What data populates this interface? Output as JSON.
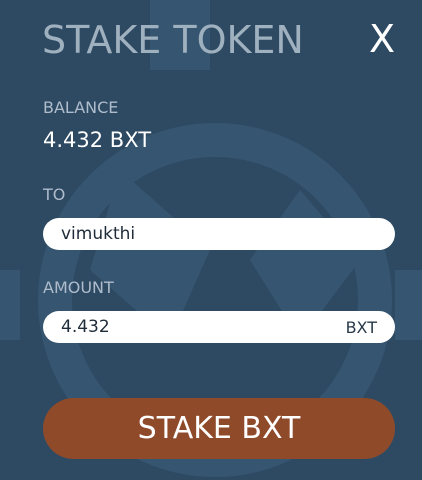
{
  "dialog": {
    "title": "STAKE TOKEN",
    "close_label": "X"
  },
  "balance": {
    "label": "BALANCE",
    "value": "4.432 BXT"
  },
  "to": {
    "label": "TO",
    "value": "vimukthi"
  },
  "amount": {
    "label": "AMOUNT",
    "value": "4.432",
    "unit": "BXT"
  },
  "submit": {
    "label": "STAKE BXT"
  },
  "colors": {
    "background": "#2e4a63",
    "title": "#9fb0bf",
    "label": "#aebccb",
    "button": "#8f4a2a",
    "field": "#ffffff"
  }
}
